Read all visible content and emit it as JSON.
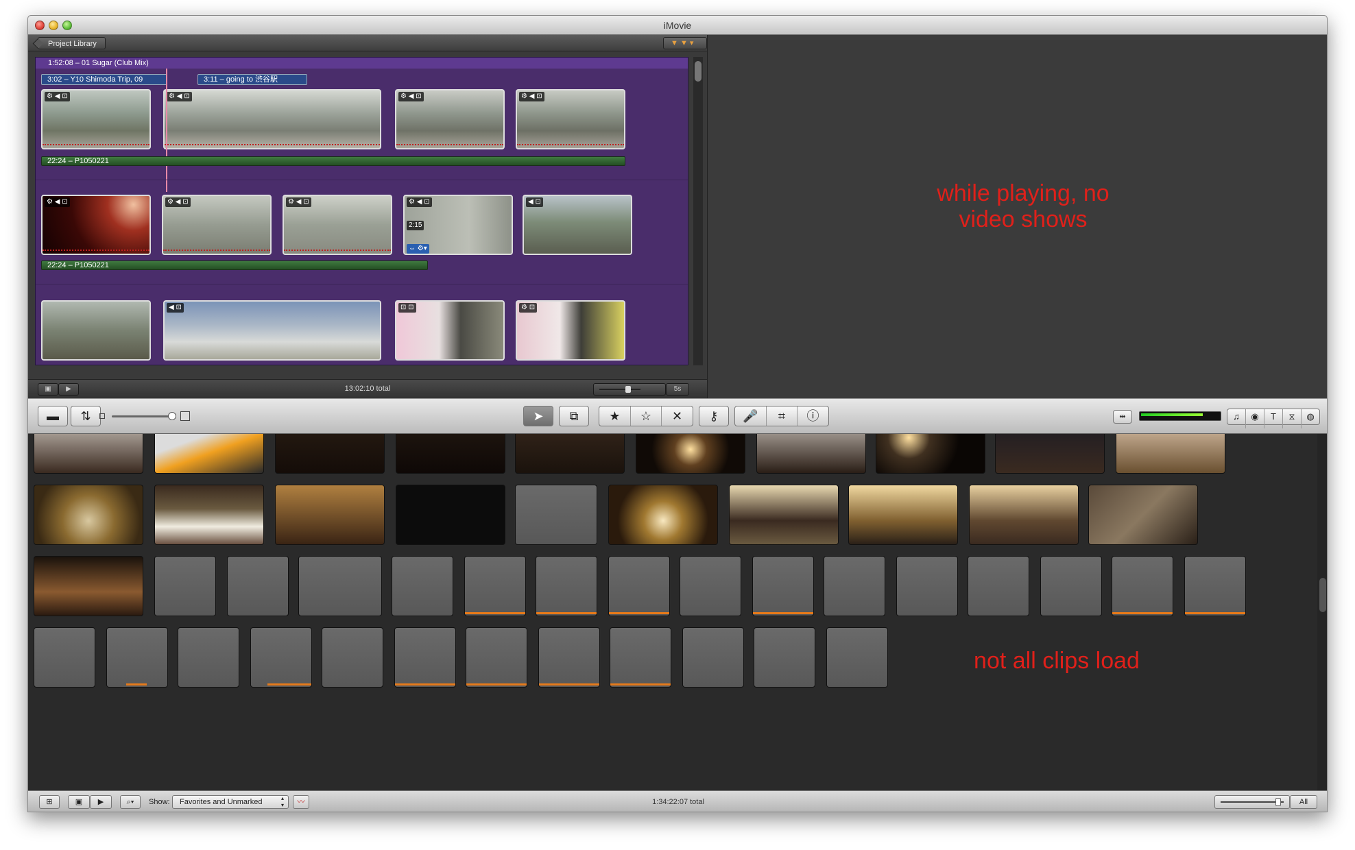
{
  "window": {
    "title": "iMovie"
  },
  "project": {
    "library_button": "Project Library",
    "header": "1:52:08 – 01 Sugar (Club Mix)",
    "clip_labels": [
      "3:02 – Y10 Shimoda Trip, 09",
      "3:11 – going to 渋谷駅"
    ],
    "green_bars": [
      "22:24 – P1050221",
      "22:24 – P1050221"
    ],
    "timecode_badge": "2:15",
    "footer_total": "13:02:10 total",
    "zoom_label": "5s"
  },
  "viewer": {
    "annotation": "while playing, no video shows"
  },
  "toolbar": {
    "buttons": [
      "camera-import",
      "swap-panes",
      "select-arrow",
      "crop-to-beat",
      "favorite",
      "unmark",
      "reject",
      "keyword",
      "voiceover",
      "crop",
      "inspector"
    ]
  },
  "events": {
    "annotation": "not all clips load",
    "show_label": "Show:",
    "show_value": "Favorites and Unmarked",
    "footer_total": "1:34:22:07 total",
    "all_label": "All"
  },
  "colors": {
    "annotation": "#e0201a",
    "project_bg": "#4a2d6b",
    "favorite_bar": "#e67a1a",
    "reject_wave": "#c02020"
  }
}
